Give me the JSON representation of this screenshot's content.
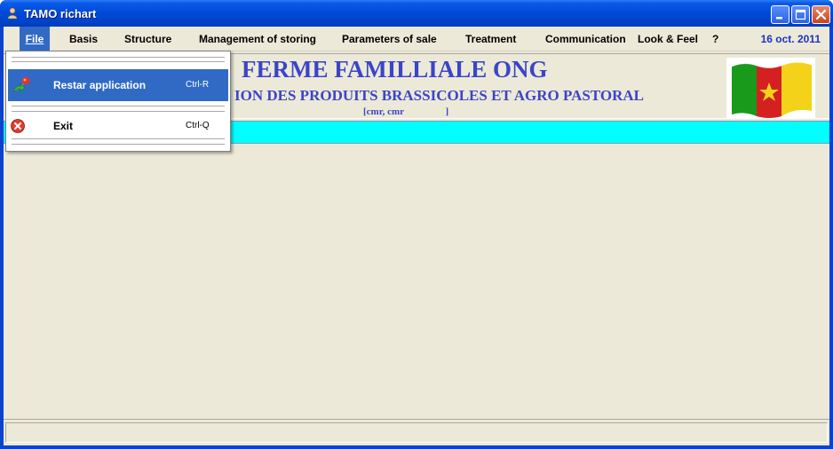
{
  "window": {
    "title": "TAMO richart",
    "icon": "user-icon"
  },
  "titlebar_buttons": {
    "minimize": "minimize-icon",
    "maximize": "maximize-icon",
    "close": "close-icon"
  },
  "menubar": {
    "items": [
      {
        "label": "File",
        "underline": "F"
      },
      {
        "label": "Basis",
        "underline": "B"
      },
      {
        "label": "Structure",
        "underline": "S"
      },
      {
        "label": "Management of storing",
        "underline": "o"
      },
      {
        "label": "Parameters of sale",
        "underline": "e"
      },
      {
        "label": "Treatment",
        "underline": "T"
      },
      {
        "label": "Communication",
        "underline": "a"
      },
      {
        "label": "Look & Feel"
      },
      {
        "label": "?"
      }
    ],
    "date": "16 oct. 2011"
  },
  "header": {
    "title": "FERME FAMILLIALE ONG",
    "subtitle": "ION DES PRODUITS BRASSICOLES ET AGRO PASTORAL",
    "code": "[cmr, cmr                 ]",
    "flag_colors": [
      "#1a9a1a",
      "#d42020",
      "#f5d21a"
    ]
  },
  "file_menu": {
    "items": [
      {
        "label": "Restar application",
        "shortcut": "Ctrl-R",
        "icon": "pushpin-arrow-icon"
      },
      {
        "label": "Exit",
        "shortcut": "Ctrl-Q",
        "icon": "red-x-close-icon"
      }
    ]
  },
  "colors": {
    "titlebar": "#0049d6",
    "menu_highlight": "#316ac5",
    "header_text": "#3a45c8",
    "cyan_bar": "#00ffff",
    "date_text": "#1a33c9",
    "background": "#ece9d8"
  }
}
